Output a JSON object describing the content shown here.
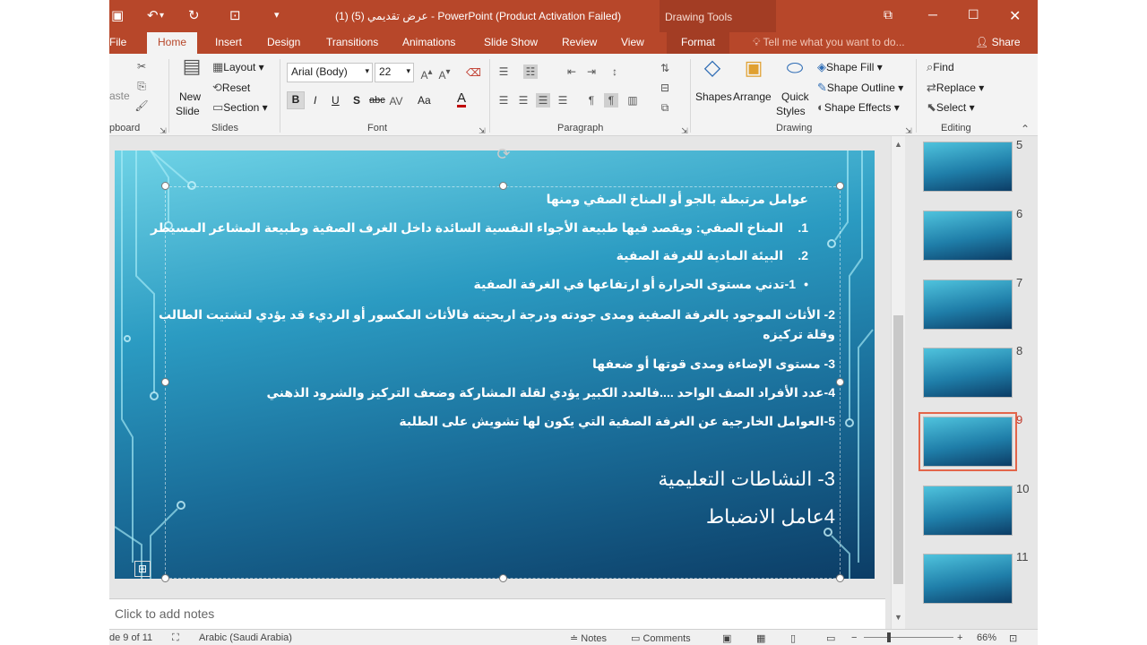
{
  "titlebar": {
    "title": "عرض تقديمي (5) (1) - PowerPoint (Product Activation Failed)",
    "drawing_tools": "Drawing Tools"
  },
  "tabs": [
    {
      "label": "File"
    },
    {
      "label": "Home"
    },
    {
      "label": "Insert"
    },
    {
      "label": "Design"
    },
    {
      "label": "Transitions"
    },
    {
      "label": "Animations"
    },
    {
      "label": "Slide Show"
    },
    {
      "label": "Review"
    },
    {
      "label": "View"
    },
    {
      "label": "Format"
    }
  ],
  "tell_me": "Tell me what you want to do...",
  "share": "Share",
  "ribbon": {
    "clipboard": {
      "label": "pboard",
      "paste": "aste"
    },
    "slides": {
      "label": "Slides",
      "new_slide_1": "New",
      "new_slide_2": "Slide",
      "layout": "Layout",
      "reset": "Reset",
      "section": "Section"
    },
    "font": {
      "label": "Font",
      "name": "Arial (Body)",
      "size": "22",
      "bold": "B",
      "italic": "I",
      "underline": "U",
      "shadow": "S",
      "strike": "abc",
      "aa": "Aa",
      "color_letter": "A"
    },
    "paragraph": {
      "label": "Paragraph"
    },
    "drawing": {
      "label": "Drawing",
      "shapes": "Shapes",
      "arrange": "Arrange",
      "quick_1": "Quick",
      "quick_2": "Styles",
      "fill": "Shape Fill",
      "outline": "Shape Outline",
      "effects": "Shape Effects"
    },
    "editing": {
      "label": "Editing",
      "find": "Find",
      "replace": "Replace",
      "select": "Select"
    }
  },
  "slide": {
    "heading": "عوامل مرتبطة بالجو أو المناخ الصفي ومنها",
    "item1": "المناخ الصفي: ويقصد فيها طبيعة الأجواء النفسية السائدة داخل الغرف الصفية وطبيعة المشاعر المسيطر",
    "item1_num": "1.",
    "item2": "البيئة المادية للغرفة الصفية",
    "item2_num": "2.",
    "bullet1": "1-تدني مستوى الحرارة أو ارتفاعها في الغرفة الصفية",
    "bullet2_l1": "2- الأثاث الموجود بالغرفة الصفية ومدى جودته ودرجة اريحيته فالأثاث المكسور أو الرديء قد يؤدي لتشتيت الطالب",
    "bullet2_l2": "وقلة تركيزه",
    "bullet3": "3- مستوى الإضاءة ومدى قوتها أو ضعفها",
    "bullet4": "4-عدد الأفراد الصف الواحد ....فالعدد الكبير يؤدي لقلة المشاركة وضعف التركيز والشرود الذهني",
    "bullet5": "5-العوامل الخارجية عن الغرفة الصفية التي يكون لها تشويش على الطلبة",
    "big1": "3- النشاطات التعليمية",
    "big2": "4عامل الانضباط"
  },
  "notes_placeholder": "Click to add notes",
  "thumbnails": [
    {
      "num": "5"
    },
    {
      "num": "6"
    },
    {
      "num": "7"
    },
    {
      "num": "8"
    },
    {
      "num": "9"
    },
    {
      "num": "10"
    },
    {
      "num": "11"
    }
  ],
  "selected_slide": "9",
  "status": {
    "slide_of": "de 9 of 11",
    "language": "Arabic (Saudi Arabia)",
    "notes": "Notes",
    "comments": "Comments",
    "zoom": "66%"
  },
  "colors": {
    "accent": "#b7472a",
    "selection": "#e3654a"
  }
}
